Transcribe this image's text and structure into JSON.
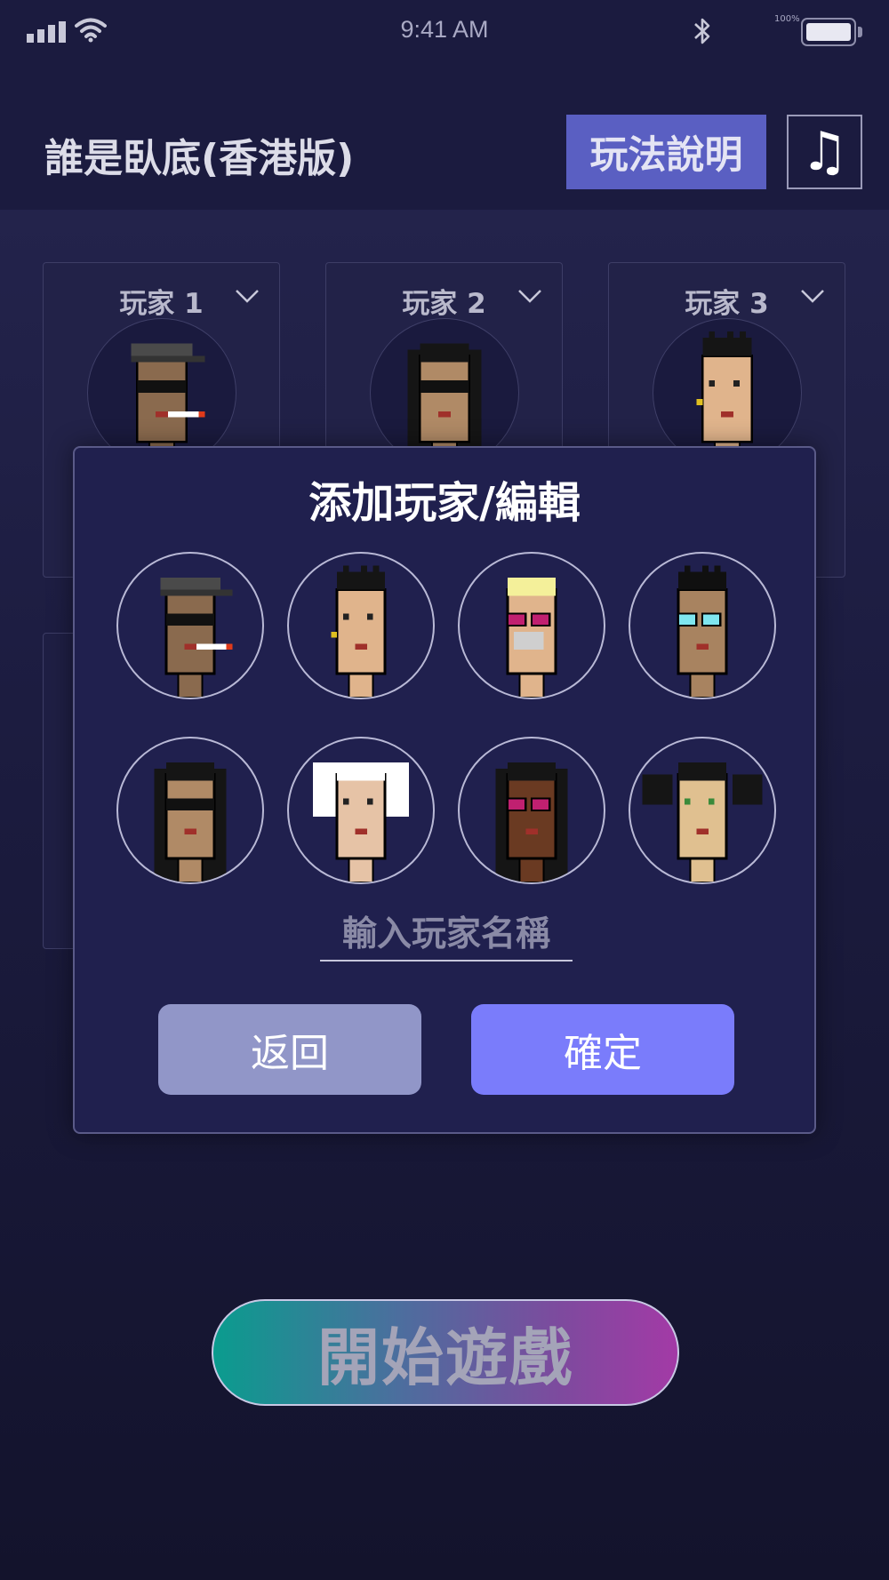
{
  "status_bar": {
    "time": "9:41 AM",
    "battery_percent": "100%",
    "icons": [
      "signal-icon",
      "wifi-icon",
      "bluetooth-icon",
      "battery-icon"
    ]
  },
  "header": {
    "title": "誰是臥底(香港版)",
    "help_label": "玩法說明",
    "music_icon": "music-note-icon"
  },
  "players": [
    {
      "label": "玩家 1",
      "avatar": "avatar-cap-smoker"
    },
    {
      "label": "玩家 2",
      "avatar": "avatar-long-hair-shades"
    },
    {
      "label": "玩家 3",
      "avatar": "avatar-spiky-hair"
    }
  ],
  "modal": {
    "title": "添加玩家/編輯",
    "avatars": [
      "avatar-cap-smoker",
      "avatar-spiky-hair",
      "avatar-blonde-pink-glasses-mask",
      "avatar-black-hair-cyan-glasses",
      "avatar-long-hair-shades",
      "avatar-white-wild-hair",
      "avatar-dark-skin-pink-glasses",
      "avatar-pigtails"
    ],
    "name_placeholder": "輸入玩家名稱",
    "name_value": "",
    "back_label": "返回",
    "confirm_label": "確定"
  },
  "start_label": "開始遊戲",
  "colors": {
    "accent": "#7a7cfb",
    "help_button": "#5a5fc2",
    "back_button": "#9196c8",
    "modal_bg": "#20204e"
  }
}
